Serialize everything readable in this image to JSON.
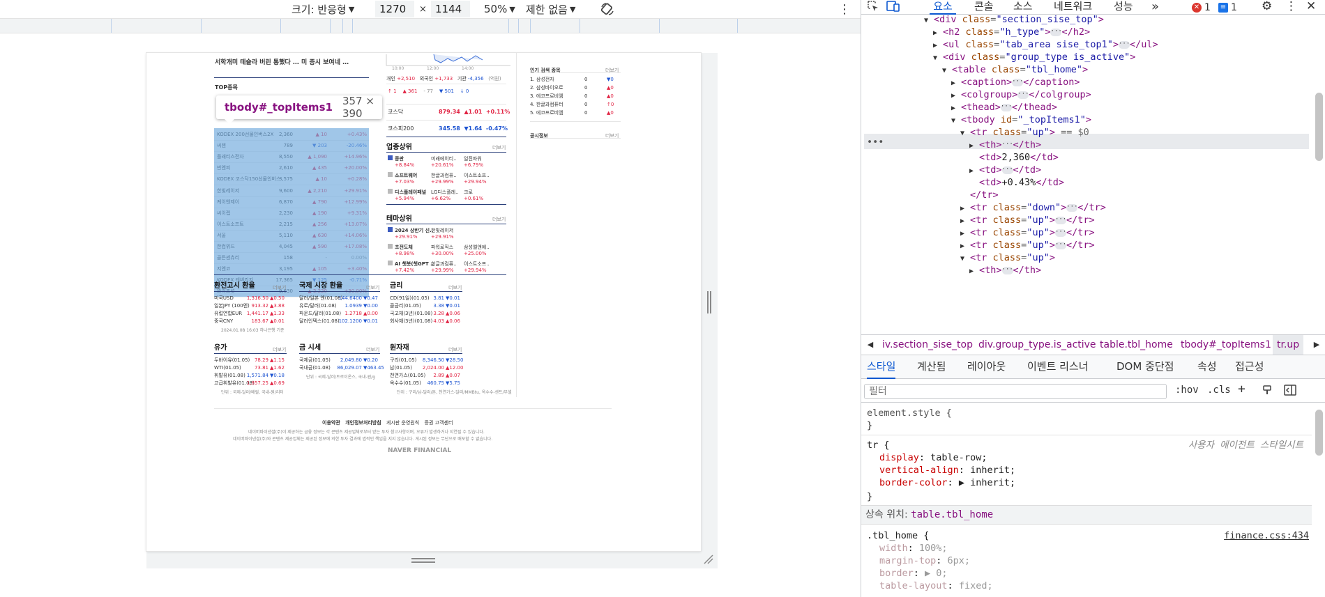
{
  "emulation": {
    "size_label": "크기: 반응형",
    "width_value": "1270",
    "times": "×",
    "height_value": "1144",
    "zoom": "50%",
    "throttle": "제한 없음"
  },
  "page": {
    "top_text": "서학개미 테슬라 버린 통했다 … 미 증시 보여네 …",
    "top_items_title": "TOP종목",
    "top_items_more": "더보기",
    "top_items": [
      [
        "KODEX 200선물인버스2X",
        "2,360",
        "▲ 10",
        "+0.43%",
        "up"
      ],
      [
        "씨젠",
        "789",
        "▼ 203",
        "-20.46%",
        "down"
      ],
      [
        "플래티스전자",
        "8,550",
        "▲ 1,090",
        "+14.96%",
        "up"
      ],
      [
        "빈엔피",
        "2,610",
        "▲ 435",
        "+20.00%",
        "up"
      ],
      [
        "KODEX 코스닥150선물인버스",
        "3,575",
        "▲ 10",
        "+0.28%",
        "up"
      ],
      [
        "한빛레이저",
        "9,600",
        "▲ 2,210",
        "+29.91%",
        "up"
      ],
      [
        "케이엔제이",
        "6,870",
        "▲ 790",
        "+12.99%",
        "up"
      ],
      [
        "씨이랩",
        "2,230",
        "▲ 190",
        "+9.31%",
        "up"
      ],
      [
        "이스트소프트",
        "2,215",
        "▲ 256",
        "+13.07%",
        "up"
      ],
      [
        "서울",
        "5,110",
        "▲ 630",
        "+14.06%",
        "up"
      ],
      [
        "한컴위드",
        "4,045",
        "▲ 590",
        "+17.08%",
        "up"
      ],
      [
        "골든센츄리",
        "158",
        "-",
        "0.00%",
        "flat"
      ],
      [
        "지엔코",
        "3,195",
        "▲ 105",
        "+3.40%",
        "up"
      ],
      [
        "KODEX 레버리지",
        "17,365",
        "▼ 125",
        "-0.71%",
        "down"
      ],
      [
        "와이즈넛",
        "9,630",
        "▲ 2,220",
        "+30.00%",
        "up"
      ]
    ],
    "market_stats": {
      "row1": [
        "개인",
        "+2,510",
        "외국인",
        "+1,733",
        "기관",
        "-4,356",
        "(억원)"
      ],
      "row2": [
        "↑ 1",
        "▲ 361",
        "- 77",
        "▼ 501",
        "↓ 0"
      ]
    },
    "indices": [
      {
        "name": "코스닥",
        "value": "879.34",
        "change": "▲1.01",
        "rate": "+0.11%",
        "dir": "up"
      },
      {
        "name": "코스피200",
        "value": "345.58",
        "change": "▼1.64",
        "rate": "-0.47%",
        "dir": "down"
      }
    ],
    "popular": {
      "title": "인기 검색 종목",
      "more": "더보기",
      "items": [
        [
          "1. 삼성전자",
          "0",
          "▼0"
        ],
        [
          "2. 삼성바이오로",
          "0",
          "▲0"
        ],
        [
          "3. 에코프로비엠",
          "0",
          "▲0"
        ],
        [
          "4. 한글과컴퓨터",
          "0",
          "↑0"
        ],
        [
          "5. 에코프로비엠",
          "0",
          "▲0"
        ]
      ]
    },
    "notice": {
      "title": "공시정보",
      "more": "더보기"
    },
    "sector": {
      "title": "업종상위",
      "more": "더보기",
      "rows": [
        [
          [
            "종판",
            "+8.84%"
          ],
          [
            "미래에이티..",
            "+20.61%"
          ],
          [
            "일진파워",
            "+6.79%"
          ]
        ],
        [
          [
            "소프트웨어",
            "+7.03%"
          ],
          [
            "한글과컴퓨..",
            "+29.99%"
          ],
          [
            "이스트소프..",
            "+29.94%"
          ]
        ],
        [
          [
            "디스플레이패널",
            "+5.94%"
          ],
          [
            "LG디스플레..",
            "+6.62%"
          ],
          [
            "크로",
            "+0.61%"
          ]
        ]
      ]
    },
    "theme": {
      "title": "테마상위",
      "more": "더보기",
      "rows": [
        [
          [
            "2024 상반기 신..",
            "+29.91%"
          ],
          [
            "한빛레이저",
            "+29.91%"
          ],
          [
            "",
            ""
          ]
        ],
        [
          [
            "초전도체",
            "+8.98%"
          ],
          [
            "파워로직스",
            "+30.00%"
          ],
          [
            "삼성엘앤에..",
            "+25.00%"
          ]
        ],
        [
          [
            "AI 챗봇(챗GPT ..",
            "+7.42%"
          ],
          [
            "한글과컴퓨..",
            "+29.99%"
          ],
          [
            "이스트소프..",
            "+29.94%"
          ]
        ]
      ]
    },
    "fx": {
      "title": "환전고시 환율",
      "more": "더보기",
      "rows": [
        [
          "미국USD",
          "1,316.50",
          "▲0.50"
        ],
        [
          "일본JPY (100엔)",
          "913.32",
          "▲3.88"
        ],
        [
          "유럽연합EUR",
          "1,441.17",
          "▲1.33"
        ],
        [
          "중국CNY",
          "183.67",
          "▲0.01"
        ]
      ],
      "note": "2024.01.08 16:03 하나은행 기준"
    },
    "intl_fx": {
      "title": "국제 시장 환율",
      "more": "더보기",
      "rows": [
        [
          "달러/일본 엔(01.08)",
          "144.6400",
          "▼0.47"
        ],
        [
          "유로/달러(01.08)",
          "1.0939",
          "▼0.00"
        ],
        [
          "파운드/달러(01.08)",
          "1.2718",
          "▲0.00"
        ],
        [
          "달러인덱스(01.08)",
          "102.1200",
          "▼0.01"
        ]
      ]
    },
    "rates": {
      "title": "금리",
      "more": "더보기",
      "rows": [
        [
          "CD(91일)(01.05)",
          "3.81",
          "▼0.01"
        ],
        [
          "콜금리(01.05)",
          "3.38",
          "▼0.01"
        ],
        [
          "국고채(3년)(01.08)",
          "3.28",
          "▲0.06"
        ],
        [
          "회사채(3년)(01.08)",
          "4.03",
          "▲0.06"
        ]
      ]
    },
    "oil": {
      "title": "유가",
      "more": "더보기",
      "rows": [
        [
          "두바이유(01.05)",
          "78.29",
          "▲1.15"
        ],
        [
          "WTI(01.05)",
          "73.81",
          "▲1.62"
        ],
        [
          "휘발유(01.08)",
          "1,571.84",
          "▼0.18"
        ],
        [
          "고급휘발유(01.08)",
          "1,857.25",
          "▲0.69"
        ]
      ],
      "note": "단위 : 국제-달러/배럴, 국내-원/리터"
    },
    "gold": {
      "title": "금 시세",
      "more": "더보기",
      "rows": [
        [
          "국제금(01.05)",
          "2,049.80",
          "▼0.20"
        ],
        [
          "국내금(01.08)",
          "86,029.07",
          "▼463.45"
        ]
      ],
      "note": "단위 : 국제-달러/트로이온스, 국내-원/g"
    },
    "raw": {
      "title": "원자재",
      "more": "더보기",
      "rows": [
        [
          "구리(01.05)",
          "8,346.50",
          "▼28.50"
        ],
        [
          "납(01.05)",
          "2,024.00",
          "▲12.00"
        ],
        [
          "천연가스(01.05)",
          "2.89",
          "▲0.07"
        ],
        [
          "옥수수(01.05)",
          "460.75",
          "▼5.75"
        ]
      ],
      "note": "단위 : 구리/납-달러/톤, 천연가스-달러/MMBtu, 옥수수-센트/부셸"
    },
    "footer": {
      "links": [
        "이용약관",
        "개인정보처리방침",
        "게시판 운영원칙",
        "증권 고객센터"
      ],
      "line1": "네이버파이낸셜(주)이 제공하는 금융 정보는 각 콘텐츠 제공업체로부터 받는 투자 참고사항이며, 오류가 발생하거나 지연될 수 있습니다.",
      "line2": "네이버파이낸셜(주)와 콘텐츠 제공업체는 제공된 정보에 의한 투자 결과에 법적인 책임을 지지 않습니다. 게시된 정보는 무단으로 배포할 수 없습니다.",
      "brand": "NAVER FINANCIAL"
    }
  },
  "tooltip": {
    "tag": "tbody#_topItems1",
    "dims": "357 × 390"
  },
  "devtools": {
    "tabs": [
      "요소",
      "콘솔",
      "소스",
      "네트워크",
      "성능"
    ],
    "more_tabs": "»",
    "error_count": "1",
    "message_count": "1",
    "dom_lines": [
      {
        "indent": 0,
        "arrow": "▼",
        "html": "<div class=\"section_sise_top\">"
      },
      {
        "indent": 1,
        "arrow": "▶",
        "html": "<h2 class=\"h_type\"> … </h2>"
      },
      {
        "indent": 1,
        "arrow": "▶",
        "html": "<ul class=\"tab_area sise_top1\"> … </ul>"
      },
      {
        "indent": 1,
        "arrow": "▼",
        "html": "<div class=\"group_type is_active\">"
      },
      {
        "indent": 2,
        "arrow": "▼",
        "html": "<table class=\"tbl_home\">"
      },
      {
        "indent": 3,
        "arrow": "▶",
        "html": "<caption> … </caption>"
      },
      {
        "indent": 3,
        "arrow": "▶",
        "html": "<colgroup> … </colgroup>"
      },
      {
        "indent": 3,
        "arrow": "▶",
        "html": "<thead> … </thead>"
      },
      {
        "indent": 3,
        "arrow": "▼",
        "html": "<tbody id=\"_topItems1\">"
      },
      {
        "indent": 4,
        "arrow": "▼",
        "html": "<tr class=\"up\"> == $0"
      },
      {
        "indent": 5,
        "arrow": "▶",
        "html": "<th> … </th>"
      },
      {
        "indent": 5,
        "arrow": "",
        "html": "<td>2,360</td>"
      },
      {
        "indent": 5,
        "arrow": "▶",
        "html": "<td> … </td>"
      },
      {
        "indent": 5,
        "arrow": "",
        "html": "<td>+0.43%</td>"
      },
      {
        "indent": 4,
        "arrow": "",
        "html": "</tr>"
      },
      {
        "indent": 4,
        "arrow": "▶",
        "html": "<tr class=\"down\"> … </tr>"
      },
      {
        "indent": 4,
        "arrow": "▶",
        "html": "<tr class=\"up\"> … </tr>"
      },
      {
        "indent": 4,
        "arrow": "▶",
        "html": "<tr class=\"up\"> … </tr>"
      },
      {
        "indent": 4,
        "arrow": "▶",
        "html": "<tr class=\"up\"> … </tr>"
      },
      {
        "indent": 4,
        "arrow": "▼",
        "html": "<tr class=\"up\">"
      },
      {
        "indent": 5,
        "arrow": "▶",
        "html": "<th> … </th>"
      }
    ],
    "breadcrumbs": [
      "iv.section_sise_top",
      "div.group_type.is_active",
      "table.tbl_home",
      "tbody#_topItems1",
      "tr.up"
    ],
    "sub_tabs": [
      "스타일",
      "계산됨",
      "레이아웃",
      "이벤트 리스너",
      "DOM 중단점",
      "속성",
      "접근성"
    ],
    "filter_placeholder": "필터",
    "hov": ":hov",
    "cls": ".cls",
    "styles": {
      "element_style": "element.style {",
      "close": "}",
      "tr_selector": "tr {",
      "ua_label": "사용자 에이전트 스타일시트",
      "tr_props": [
        [
          "display",
          "table-row;"
        ],
        [
          "vertical-align",
          "inherit;"
        ],
        [
          "border-color",
          "▶ inherit;"
        ]
      ],
      "inherit_label": "상속 위치:",
      "inherit_from": "table.tbl_home",
      "tbl_selector": ".tbl_home {",
      "tbl_source": "finance.css:434",
      "tbl_props": [
        [
          "width",
          "100%;"
        ],
        [
          "margin-top",
          "6px;"
        ],
        [
          "border",
          "▶ 0;"
        ],
        [
          "table-layout",
          "fixed;"
        ]
      ]
    }
  }
}
